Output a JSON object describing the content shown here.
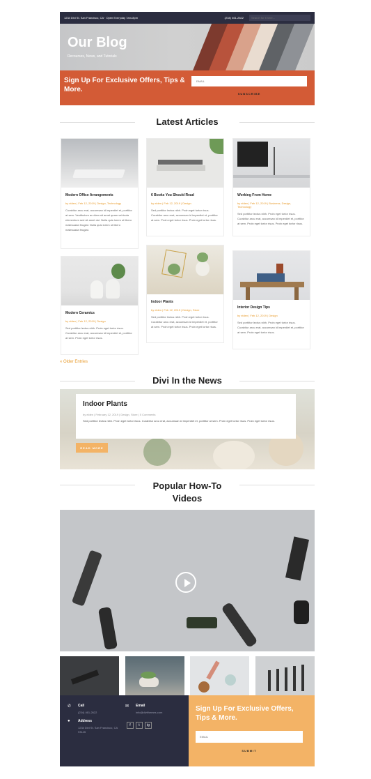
{
  "topbar": {
    "address": "1234 Divi St. San Francisco, CA · Open Everyday 7am-8pm",
    "phone": "(234) 461-2622",
    "search_placeholder": "Search for it here..."
  },
  "hero": {
    "title": "Our Blog",
    "subtitle": "Recourses, News, and Tutorials"
  },
  "signup_top": {
    "text": "Sign Up For Exclusive Offers, Tips & More.",
    "email_placeholder": "EMAIL",
    "button": "SUBSCRIBE"
  },
  "latest": {
    "heading": "Latest Articles",
    "articles": [
      {
        "title": "Modern Office Arrangements",
        "meta": "by elden | Feb 12, 2019 | Design, Technology",
        "excerpt": "Curabitur arcu erat, accumsan id imperdiet et, porttitor at sem. Vestibulum ac diam sit amet quam vehicula elementum sed sit amet dui. Nulla quis lorem ut libero malesuada feugiat. Nulla quis lorem ut libero malesuada feugiat."
      },
      {
        "title": "6 Books You Should Read",
        "meta": "by elden | Feb 12, 2019 | Design",
        "excerpt": "Sed porttitor lectus nibh. Proin eget tortor risus. Curabitur arcu erat, accumsan id imperdiet et, porttitor at sem. Proin eget tortor risus. Proin eget tortor risus."
      },
      {
        "title": "Working From Home",
        "meta": "by elden | Feb 12, 2019 | Business, Design, Technology",
        "excerpt": "Sed porttitor lectus nibh. Proin eget tortor risus. Curabitur arcu erat, accumsan id imperdiet et, porttitor at sem. Proin eget tortor risus. Proin eget tortor risus."
      },
      {
        "title": "Modern Ceramics",
        "meta": "by elden | Feb 12, 2019 | Design",
        "excerpt": "Sed porttitor lectus nibh. Proin eget tortor risus. Curabitur arcu erat, accumsan id imperdiet et, porttitor at sem. Proin eget tortor risus."
      },
      {
        "title": "Indoor Plants",
        "meta": "by elden | Feb 12, 2019 | Design, Store",
        "excerpt": "Sed porttitor lectus nibh. Proin eget tortor risus. Curabitur arcu erat, accumsan id imperdiet et, porttitor at sem. Proin eget tortor risus. Proin eget tortor risus."
      },
      {
        "title": "Interior Design Tips",
        "meta": "by elden | Feb 12, 2019 | Design",
        "excerpt": "Sed porttitor lectus nibh. Proin eget tortor risus. Curabitur arcu erat, accumsan id imperdiet et, porttitor at sem. Proin eget tortor risus."
      }
    ],
    "older_entries": "« Older Entries"
  },
  "news": {
    "heading": "Divi In the News",
    "title": "Indoor Plants",
    "meta": "by elden | February 12, 2019 | Design, Store | 0 Comments",
    "excerpt": "Sed porttitor lectus nibh. Proin eget tortor risus. Curabitur arcu erat, accumsan id imperdiet et, porttitor at sem. Proin eget tortor risus. Proin eget tortor risus.",
    "button": "READ MORE"
  },
  "videos": {
    "heading": "Popular How-To Videos"
  },
  "footer": {
    "call_label": "Call",
    "call_value": "(234) 461-2622",
    "email_label": "Email",
    "email_value": "info@divithemes.com",
    "address_label": "Address",
    "address_value": "1234 Divi St. San Francisco, CA 93145",
    "social": [
      "f",
      "t",
      "ig"
    ],
    "signup_text": "Sign Up For Exclusive Offers, Tips & More.",
    "email_placeholder": "EMAIL",
    "button": "SUBMIT"
  },
  "colors": {
    "topbar": "#2b2d40",
    "signup_orange": "#d35b36",
    "accent_yellow": "#f3b366",
    "meta_orange": "#e89b2c"
  }
}
